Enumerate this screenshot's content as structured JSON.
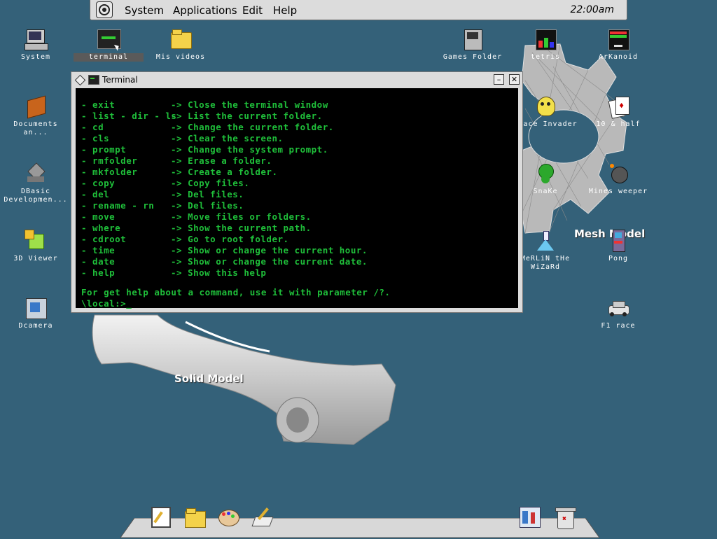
{
  "menubar": {
    "items": [
      "System",
      "Applications",
      "Edit",
      "Help"
    ],
    "clock": "22:00am"
  },
  "desktop_icons": [
    {
      "label": "System"
    },
    {
      "label": "terminal"
    },
    {
      "label": "Mis videos"
    },
    {
      "label": "Documents an..."
    },
    {
      "label": "DBasic Developmen..."
    },
    {
      "label": "3D Viewer"
    },
    {
      "label": "Dcamera"
    },
    {
      "label": "Games Folder"
    },
    {
      "label": "tetris"
    },
    {
      "label": "ArKanoid"
    },
    {
      "label": "Space Invader"
    },
    {
      "label": "10 & half"
    },
    {
      "label": "SnaKe"
    },
    {
      "label": "Mines weeper"
    },
    {
      "label": "MeRLiN tHe WiZaRd"
    },
    {
      "label": "Pong"
    },
    {
      "label": "F1 race"
    }
  ],
  "background_labels": {
    "mesh": "Mesh Model",
    "solid": "Solid Model"
  },
  "terminal": {
    "title": "Terminal",
    "help_lines": [
      {
        "cmd": "- exit",
        "desc": "-> Close the terminal window"
      },
      {
        "cmd": "- list - dir - ls",
        "desc": "-> List the current folder."
      },
      {
        "cmd": "- cd",
        "desc": "-> Change the current folder."
      },
      {
        "cmd": "- cls",
        "desc": "-> Clear the screen."
      },
      {
        "cmd": "- prompt",
        "desc": "-> Change the system prompt."
      },
      {
        "cmd": "- rmfolder",
        "desc": "-> Erase a folder."
      },
      {
        "cmd": "- mkfolder",
        "desc": "-> Create a folder."
      },
      {
        "cmd": "- copy",
        "desc": "-> Copy files."
      },
      {
        "cmd": "- del",
        "desc": "-> Del files."
      },
      {
        "cmd": "- rename - rn",
        "desc": "-> Del files."
      },
      {
        "cmd": "- move",
        "desc": "-> Move files or folders."
      },
      {
        "cmd": "- where",
        "desc": "-> Show the current path."
      },
      {
        "cmd": "- cdroot",
        "desc": "-> Go to root folder."
      },
      {
        "cmd": "- time",
        "desc": "-> Show or change the current hour."
      },
      {
        "cmd": "- date",
        "desc": "-> Show or change the current date."
      },
      {
        "cmd": "- help",
        "desc": "-> Show this help"
      }
    ],
    "footer": "For get help about a command, use it with parameter /?.",
    "prompt": "\\local:>_"
  },
  "colors": {
    "desktop": "#346179",
    "terminal_text": "#1fbf3a"
  }
}
